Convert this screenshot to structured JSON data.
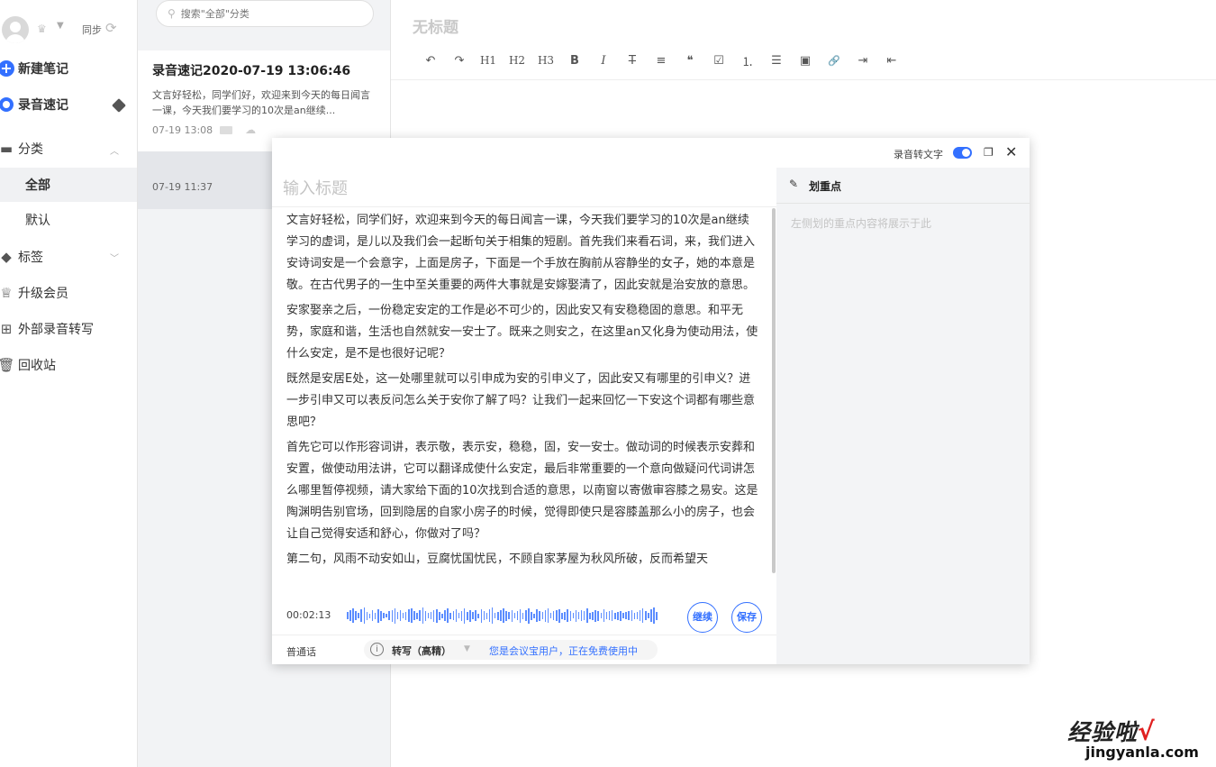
{
  "sidebar": {
    "sync_label": "同步",
    "new_note": "新建笔记",
    "voice_note": "录音速记",
    "category": "分类",
    "all": "全部",
    "default": "默认",
    "tags": "标签",
    "upgrade": "升级会员",
    "external": "外部录音转写",
    "trash": "回收站"
  },
  "list": {
    "search_placeholder": "搜索\"全部\"分类",
    "notes": [
      {
        "title": "录音速记2020-07-19 13:06:46",
        "preview": "文言好轻松，同学们好，欢迎来到今天的每日闻言一课，今天我们要学习的10次是an继续...",
        "date": "07-19 13:08"
      },
      {
        "date": "07-19 11:37"
      }
    ]
  },
  "editor": {
    "title": "无标题",
    "toolbar": [
      "↶",
      "↷",
      "H1",
      "H2",
      "H3",
      "B",
      "I",
      "T̶",
      "≡",
      "❝",
      "☑",
      "⒈",
      "☰",
      "▣",
      "🔗",
      "⇥",
      "⇤"
    ]
  },
  "modal": {
    "rec_to_text_label": "录音转文字",
    "title_placeholder": "输入标题",
    "paragraphs": [
      "文言好轻松，同学们好，欢迎来到今天的每日闻言一课，今天我们要学习的10次是an继续学习的虚词，是儿以及我们会一起断句关于相集的短剧。首先我们来看石词，来，我们进入安诗词安是一个会意字，上面是房子，下面是一个手放在胸前从容静坐的女子，她的本意是敬。在古代男子的一生中至关重要的两件大事就是安嫁娶清了，因此安就是治安放的意思。",
      "安家娶亲之后，一份稳定安定的工作是必不可少的，因此安又有安稳稳固的意思。和平无势，家庭和谐，生活也自然就安一安士了。既来之则安之，在这里an又化身为使动用法，使什么安定，是不是也很好记呢？",
      "既然是安居E处，这一处哪里就可以引申成为安的引申义了，因此安又有哪里的引申义？进一步引申又可以表反问怎么关于安你了解了吗？让我们一起来回忆一下安这个词都有哪些意思吧？",
      "首先它可以作形容词讲，表示敬，表示安，稳稳，固，安一安士。做动词的时候表示安葬和安置，做使动用法讲，它可以翻译成使什么安定，最后非常重要的一个意向做疑问代词讲怎么哪里暂停视频，请大家给下面的10次找到合适的意思，以南窗以寄傲审容膝之易安。这是陶渊明告别官场，回到隐居的自家小房子的时候，觉得即使只是容膝盖那么小的房子，也会让自己觉得安适和舒心，你做对了吗？",
      "第二句，风雨不动安如山，豆腐忧国忧民，不顾自家茅屋为秋风所破，反而希望天"
    ],
    "time": "00:02:13",
    "continue_btn": "继续",
    "save_btn": "保存",
    "language": "普通话",
    "mode": "转写（高精）",
    "notice": "您是会议宝用户，正在免费使用中",
    "highlight_title": "划重点",
    "highlight_empty": "左侧划的重点内容将展示于此"
  },
  "watermark": {
    "top": "经验啦",
    "check": "√",
    "bottom": "jingyanla.com"
  }
}
